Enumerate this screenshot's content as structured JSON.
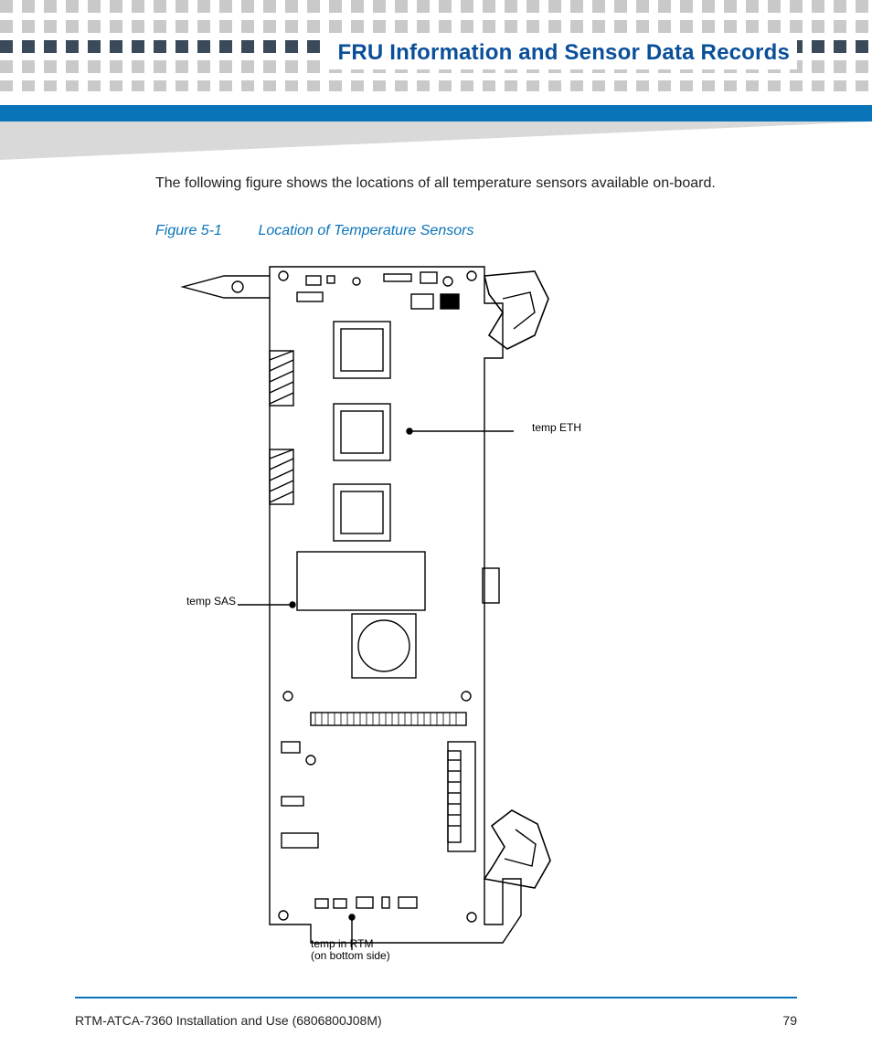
{
  "header": {
    "chapter_title": "FRU Information and Sensor Data Records"
  },
  "body": {
    "intro": "The following figure shows the locations of all temperature sensors available on-board.",
    "figure": {
      "number": "Figure 5-1",
      "title": "Location of Temperature Sensors",
      "callouts": {
        "eth": "temp ETH",
        "sas": "temp SAS",
        "rtm_line1": "temp in RTM",
        "rtm_line2": "(on bottom side)"
      }
    }
  },
  "footer": {
    "doc_title": "RTM-ATCA-7360 Installation and Use (6806800J08M)",
    "page_number": "79"
  }
}
